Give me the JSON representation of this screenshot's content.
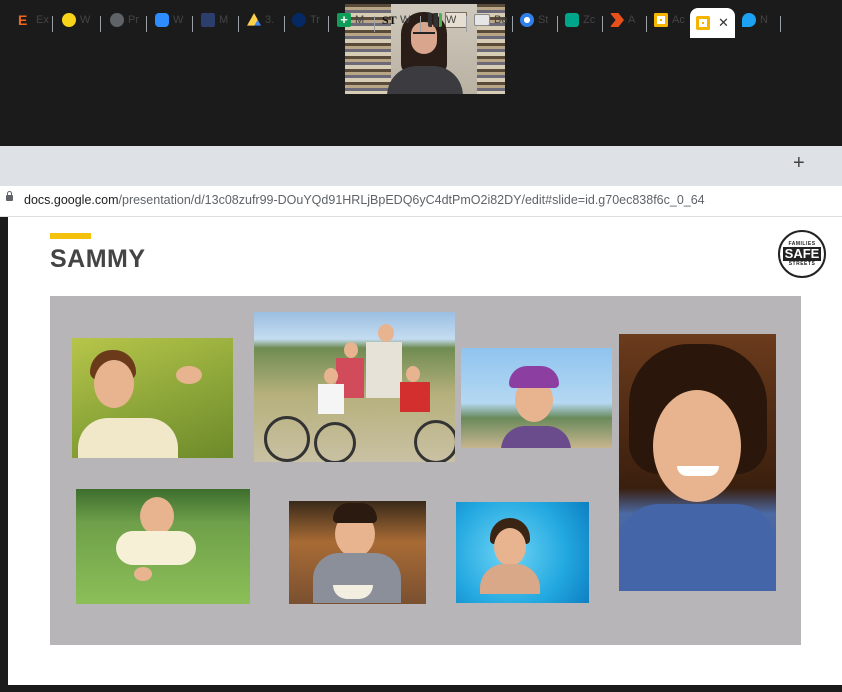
{
  "video_call": {
    "participant_tile": "participant video"
  },
  "browser": {
    "tabs": [
      {
        "label": "Ex",
        "icon": "etsy-icon",
        "color": "#f1641e"
      },
      {
        "label": "W",
        "icon": "lt-icon",
        "color": "#f7d31a"
      },
      {
        "label": "Pr",
        "icon": "globe-icon",
        "color": "#5f6368"
      },
      {
        "label": "W",
        "icon": "zoom-icon",
        "color": "#2d8cff"
      },
      {
        "label": "M",
        "icon": "building-icon",
        "color": "#2c3e6b"
      },
      {
        "label": "3.",
        "icon": "google-drive-icon",
        "color": "#1fa463"
      },
      {
        "label": "Tr",
        "icon": "guardian-icon",
        "color": "#052962"
      },
      {
        "label": "M",
        "icon": "plus-square-icon",
        "color": "#0f9d58"
      },
      {
        "label": "W",
        "icon": "wsj-icon",
        "color": "#111111"
      },
      {
        "label": "W",
        "icon": "chart-icon",
        "color": "#333333"
      },
      {
        "label": "Be",
        "icon": "mail-icon",
        "color": "#8a8a8a"
      },
      {
        "label": "St",
        "icon": "sun-icon",
        "color": "#2f80ed"
      },
      {
        "label": "Zc",
        "icon": "zapier-icon",
        "color": "#00a68a"
      },
      {
        "label": "A",
        "icon": "chevron-icon",
        "color": "#e8501c"
      },
      {
        "label": "Ac",
        "icon": "slides-icon",
        "color": "#f4b400"
      },
      {
        "label": "",
        "icon": "slides-icon",
        "color": "#f4b400",
        "active": true
      },
      {
        "label": "N",
        "icon": "twitter-icon",
        "color": "#1da1f2"
      }
    ],
    "close_glyph": "✕",
    "new_tab_glyph": "+",
    "url_host": "docs.google.com",
    "url_path": "/presentation/d/13c08zufr99-DOuYQd91HRLjBpEDQ6yC4dtPmO2i82DY/edit#slide=id.g70ec838f6c_0_64"
  },
  "slide": {
    "title": "SAMMY",
    "accent_color": "#f4c20d",
    "logo": {
      "top_text": "FAMILIES",
      "middle_text": "SAFE",
      "bottom_text": "STREETS",
      "small_text": "FOR"
    },
    "photos": [
      "toddler-in-grass",
      "family-with-bicycles-on-beach",
      "boy-with-purple-cap",
      "smiling-boy-portrait",
      "baby-crawling-on-lawn",
      "boy-at-table-with-bowl",
      "boy-in-swimming-pool"
    ]
  }
}
